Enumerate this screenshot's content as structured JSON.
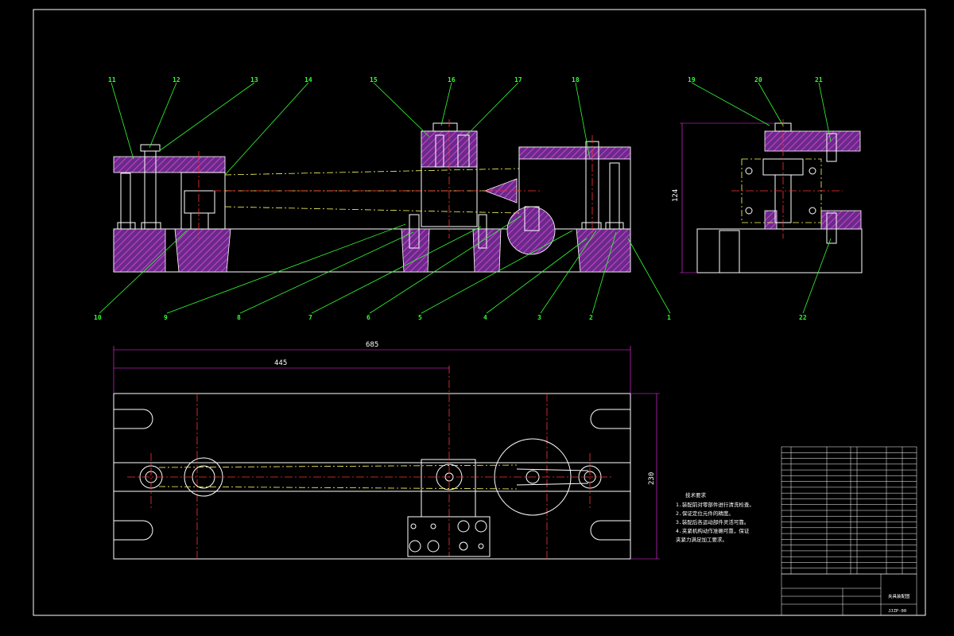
{
  "drawing": {
    "balloons_top_row": [
      "11",
      "12",
      "13",
      "14",
      "15",
      "16",
      "17",
      "18",
      "19",
      "20",
      "21"
    ],
    "balloons_bottom_row": [
      "10",
      "9",
      "8",
      "7",
      "6",
      "5",
      "4",
      "3",
      "2",
      "1",
      "22"
    ],
    "dimensions": {
      "overall_length": "685",
      "partial_length": "445",
      "height_side": "124",
      "width_plan": "230"
    },
    "tech_notes": {
      "title": "技术要求",
      "lines": [
        "1.装配前对零部件进行清洗检查。",
        "2.保证定位元件的精度。",
        "3.装配后各运动部件灵活可靠。",
        "4.夹紧机构动作准确可靠，保证",
        "夹紧力满足加工要求。"
      ]
    },
    "title_block": {
      "part_name": "夹具装配图",
      "drawing_no": "JJZP-00"
    }
  }
}
